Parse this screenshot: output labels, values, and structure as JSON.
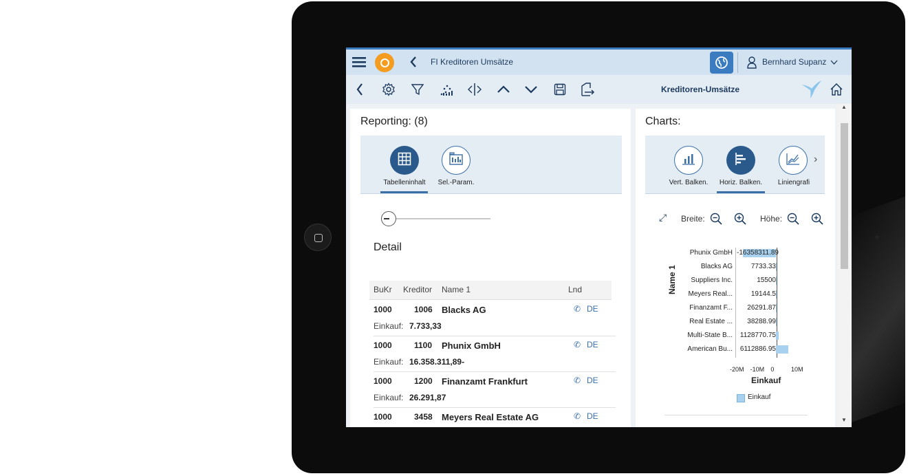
{
  "shell": {
    "title": "FI Kreditoren Umsätze",
    "user": "Bernhard Supanz"
  },
  "toolbar": {
    "title": "Kreditoren-Umsätze"
  },
  "reporting": {
    "title": "Reporting: (8)",
    "tabs": [
      {
        "label": "Tabelleninhalt",
        "active": true,
        "icon": "table-icon"
      },
      {
        "label": "Sel.-Param.",
        "active": false,
        "icon": "selection-parameters-icon"
      }
    ],
    "detail_label": "Detail",
    "table": {
      "headers": [
        "BuKr",
        "Kreditor",
        "Name 1",
        "Lnd"
      ],
      "rows": [
        {
          "bukr": "1000",
          "kreditor": "1006",
          "name": "Blacks AG",
          "lnd": "DE",
          "einkauf_label": "Einkauf:",
          "einkauf": "7.733,33"
        },
        {
          "bukr": "1000",
          "kreditor": "1100",
          "name": "Phunix GmbH",
          "lnd": "DE",
          "einkauf_label": "Einkauf:",
          "einkauf": "16.358.311,89-"
        },
        {
          "bukr": "1000",
          "kreditor": "1200",
          "name": "Finanzamt Frankfurt",
          "lnd": "DE",
          "einkauf_label": "Einkauf:",
          "einkauf": "26.291,87"
        },
        {
          "bukr": "1000",
          "kreditor": "3458",
          "name": "Meyers Real Estate AG",
          "lnd": "DE"
        }
      ]
    }
  },
  "charts": {
    "title": "Charts:",
    "tabs": [
      {
        "label": "Vert. Balken.",
        "active": false,
        "icon": "vertical-bar-chart-icon"
      },
      {
        "label": "Horiz. Balken.",
        "active": true,
        "icon": "horizontal-bar-chart-icon"
      },
      {
        "label": "Liniengrafi",
        "active": false,
        "icon": "line-chart-icon"
      }
    ],
    "zoom": {
      "breite_label": "Breite:",
      "hoehe_label": "Höhe:"
    }
  },
  "chart_data": {
    "type": "bar",
    "orientation": "horizontal",
    "categories": [
      "Phunix GmbH",
      "Blacks AG",
      "Suppliers Inc.",
      "Meyers Real...",
      "Finanzamt F...",
      "Real Estate ...",
      "Multi-State B...",
      "American Bu..."
    ],
    "series": [
      {
        "name": "Einkauf",
        "values": [
          -16358311.89,
          7733.33,
          15500,
          19144.5,
          26291.87,
          38288.99,
          1128770.75,
          6112886.95
        ]
      }
    ],
    "value_labels": [
      "-16358311.89",
      "7733.33",
      "15500",
      "19144.5",
      "26291.87",
      "38288.99",
      "1128770.75",
      "6112886.95"
    ],
    "xlabel": "Einkauf",
    "ylabel": "Name 1",
    "xticks": [
      "-20M",
      "-10M",
      "0",
      "10M"
    ],
    "xlim": [
      -20000000,
      10000000
    ],
    "legend": "bottom",
    "color": "#a7d1ee"
  }
}
